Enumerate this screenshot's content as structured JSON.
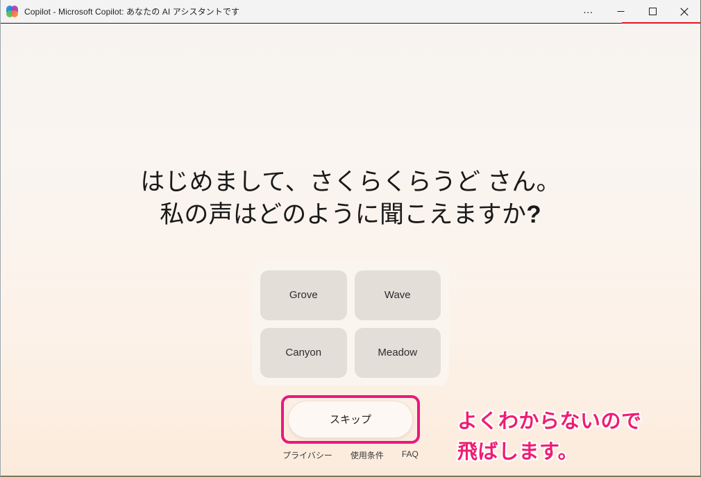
{
  "window": {
    "title": "Copilot - Microsoft Copilot: あなたの AI アシスタントです",
    "app_icon": "copilot-icon",
    "controls": {
      "more": "…",
      "minimize": "minimize-icon",
      "maximize": "maximize-icon",
      "close": "close-icon"
    },
    "accent_red": "#e81123"
  },
  "main": {
    "heading_line1": "はじめまして、さくらくらうど さん。",
    "heading_line2_text": "私の声はどのように聞こえますか",
    "heading_line2_mark": "?",
    "voice_options": [
      {
        "label": "Grove"
      },
      {
        "label": "Wave"
      },
      {
        "label": "Canyon"
      },
      {
        "label": "Meadow"
      }
    ],
    "skip_label": "スキップ",
    "footer_links": [
      {
        "label": "プライバシー"
      },
      {
        "label": "使用条件"
      },
      {
        "label": "FAQ"
      }
    ]
  },
  "annotation": {
    "line1": "よくわからないので",
    "line2": "飛ばします。",
    "color": "#ef1d72",
    "highlight_color": "#e8197d"
  }
}
